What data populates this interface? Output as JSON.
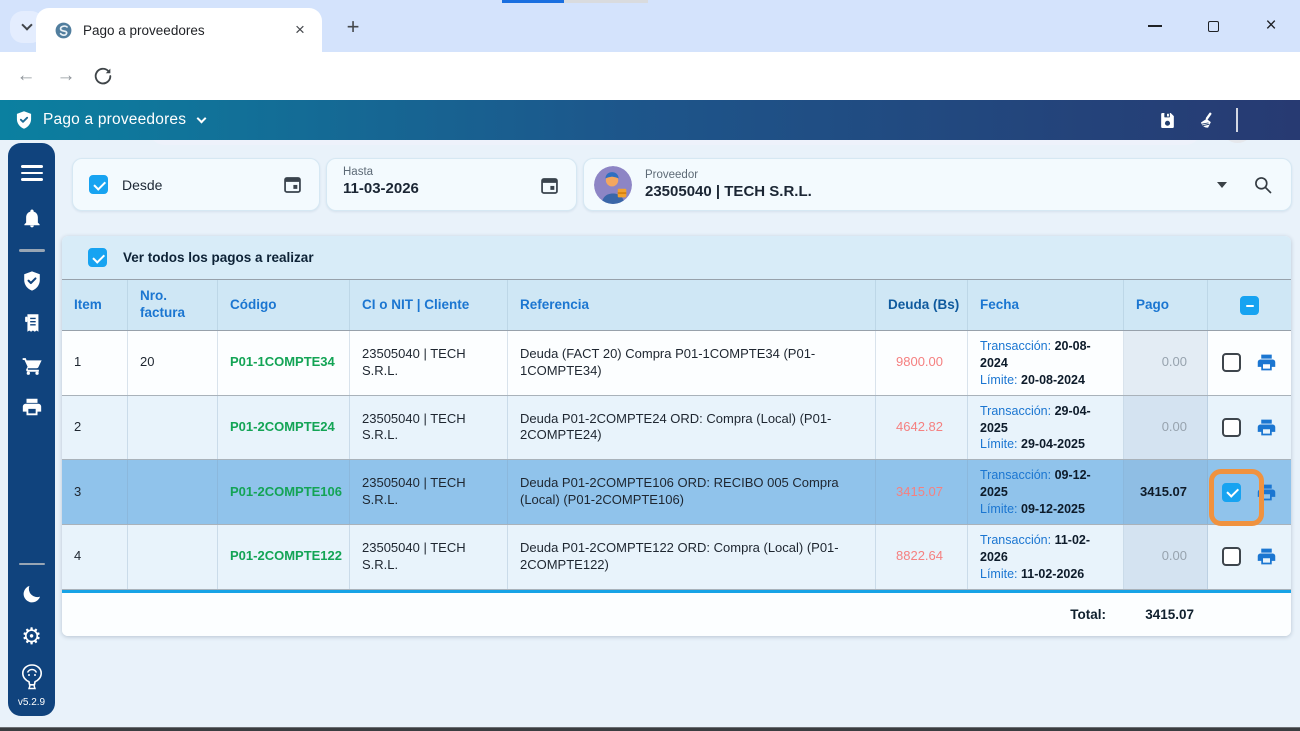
{
  "glyphs": {
    "close": "×",
    "plus": "+",
    "menu_dots": "⋮",
    "back": "←",
    "forward": "→",
    "gear": "⚙"
  },
  "browser": {
    "tab_title": "Pago a proveedores",
    "address_value": ""
  },
  "app_header": {
    "title": "Pago a proveedores"
  },
  "sidebar": {
    "version": "v5.2.9"
  },
  "filters": {
    "desde_label": "Desde",
    "hasta_label": "Hasta",
    "hasta_value": "11-03-2026",
    "proveedor_label": "Proveedor",
    "proveedor_value": "23505040 | TECH S.R.L."
  },
  "banner": {
    "label": "Ver todos los pagos a realizar"
  },
  "table": {
    "columns": [
      "Item",
      "Nro. factura",
      "Código",
      "CI o NIT | Cliente",
      "Referencia",
      "Deuda (Bs)",
      "Fecha",
      "Pago"
    ],
    "fecha_labels": {
      "transaccion": "Transacción:",
      "limite": "Límite:"
    },
    "rows": [
      {
        "item": "1",
        "factura": "20",
        "codigo": "P01-1COMPTE34",
        "cliente": "23505040 | TECH S.R.L.",
        "referencia": "Deuda (FACT 20) Compra P01-1COMPTE34 (P01-1COMPTE34)",
        "deuda": "9800.00",
        "transaccion": "20-08-2024",
        "limite": "20-08-2024",
        "pago": "0.00",
        "checked": false,
        "selected": false,
        "highlight_ring": false
      },
      {
        "item": "2",
        "factura": "",
        "codigo": "P01-2COMPTE24",
        "cliente": "23505040 | TECH S.R.L.",
        "referencia": "Deuda P01-2COMPTE24 ORD: Compra (Local) (P01-2COMPTE24)",
        "deuda": "4642.82",
        "transaccion": "29-04-2025",
        "limite": "29-04-2025",
        "pago": "0.00",
        "checked": false,
        "selected": false,
        "highlight_ring": false
      },
      {
        "item": "3",
        "factura": "",
        "codigo": "P01-2COMPTE106",
        "cliente": "23505040 | TECH S.R.L.",
        "referencia": "Deuda P01-2COMPTE106 ORD: RECIBO 005 Compra (Local) (P01-2COMPTE106)",
        "deuda": "3415.07",
        "transaccion": "09-12-2025",
        "limite": "09-12-2025",
        "pago": "3415.07",
        "checked": true,
        "selected": true,
        "highlight_ring": true
      },
      {
        "item": "4",
        "factura": "",
        "codigo": "P01-2COMPTE122",
        "cliente": "23505040 | TECH S.R.L.",
        "referencia": "Deuda P01-2COMPTE122 ORD: Compra (Local) (P01-2COMPTE122)",
        "deuda": "8822.64",
        "transaccion": "11-02-2026",
        "limite": "11-02-2026",
        "pago": "0.00",
        "checked": false,
        "selected": false,
        "highlight_ring": false
      }
    ],
    "total_label": "Total:",
    "total_value": "3415.07"
  },
  "colors": {
    "accent_azure": "#17a3f1",
    "selected_row": "#90c3eb",
    "deuda_red": "#f58080",
    "codigo_green": "#13a455",
    "link_blue": "#1b76d1",
    "header_gradient_start": "#0b80a0",
    "header_gradient_end": "#273a72",
    "sidebar_navy": "#10437d",
    "highlight_ring_orange": "#f0923f"
  }
}
